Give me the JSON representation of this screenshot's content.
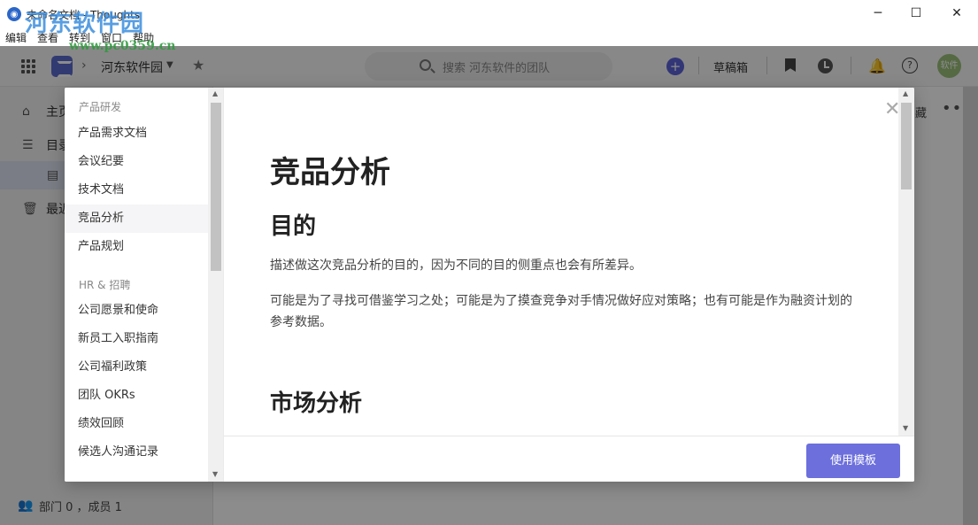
{
  "window": {
    "title": "未命名文档 - Thoughts",
    "minimize": "─",
    "maximize": "☐",
    "close": "✕"
  },
  "watermark": {
    "main": "河东软件园",
    "url": "www.pc0359.cn"
  },
  "menu": [
    "编辑",
    "查看",
    "转到",
    "窗口",
    "帮助"
  ],
  "header": {
    "workspace": "河东软件园",
    "search_placeholder": "搜索 河东软件的团队",
    "plus": "+",
    "drafts": "草稿箱",
    "avatar_text": "软件"
  },
  "sidebar": {
    "items": [
      {
        "icon": "⌂",
        "label": "主页"
      },
      {
        "icon": "☰",
        "label": "目录"
      },
      {
        "icon": "▤",
        "label": ""
      },
      {
        "icon": "🗑",
        "label": "最近"
      }
    ],
    "footer": "部门 0 ，成员 1"
  },
  "background_right": {
    "fragment": "藏",
    "more": "•••"
  },
  "modal": {
    "groups": [
      {
        "name": "产品研发",
        "items": [
          "产品需求文档",
          "会议纪要",
          "技术文档",
          "竞品分析",
          "产品规划"
        ]
      },
      {
        "name": "HR & 招聘",
        "items": [
          "公司愿景和使命",
          "新员工入职指南",
          "公司福利政策",
          "团队 OKRs",
          "绩效回顾",
          "候选人沟通记录"
        ]
      }
    ],
    "selected": "竞品分析",
    "preview": {
      "title": "竞品分析",
      "h_purpose": "目的",
      "p1": "描述做这次竞品分析的目的，因为不同的目的侧重点也会有所差异。",
      "p2": "可能是为了寻找可借鉴学习之处；可能是为了摸查竞争对手情况做好应对策略；也有可能是作为融资计划的参考数据。",
      "h_market": "市场分析"
    },
    "close": "✕",
    "use_button": "使用模板"
  }
}
